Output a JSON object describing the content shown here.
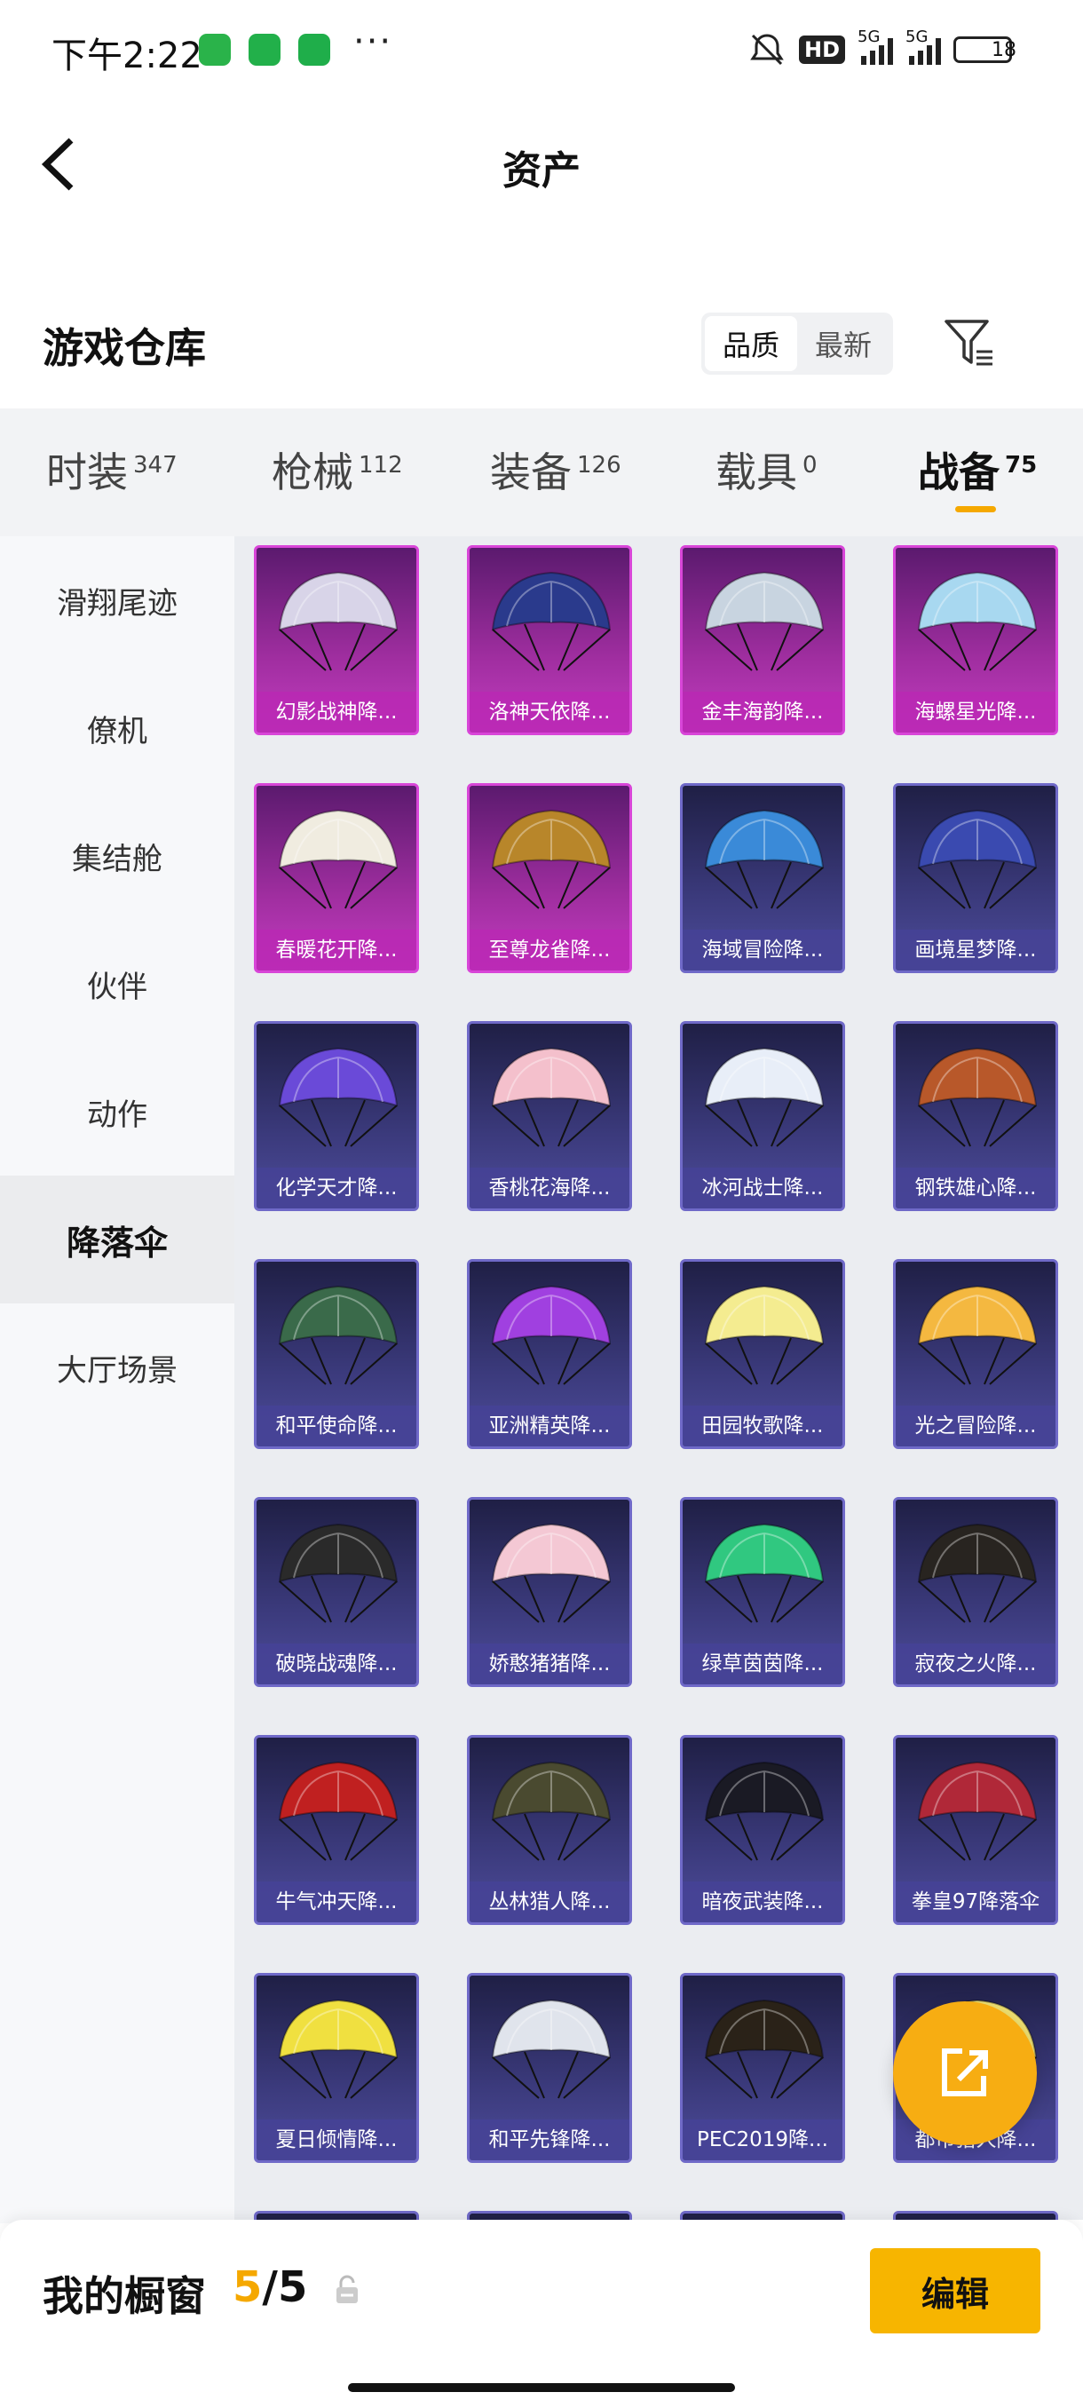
{
  "status_bar": {
    "time": "下午2:22",
    "network_hd": "HD",
    "signal_1": "5G",
    "signal_2": "5G",
    "battery": "18",
    "more": "···"
  },
  "nav": {
    "title": "资产"
  },
  "warehouse": {
    "title": "游戏仓库",
    "sort_options": [
      "品质",
      "最新"
    ],
    "sort_selected": "品质"
  },
  "tabs": [
    {
      "label": "时装",
      "count": "347"
    },
    {
      "label": "枪械",
      "count": "112"
    },
    {
      "label": "装备",
      "count": "126"
    },
    {
      "label": "载具",
      "count": "0"
    },
    {
      "label": "战备",
      "count": "75"
    }
  ],
  "sidebar": {
    "items": [
      "滑翔尾迹",
      "僚机",
      "集结舱",
      "伙伴",
      "动作",
      "降落伞",
      "大厅场景"
    ],
    "active": "降落伞"
  },
  "items": [
    {
      "name": "幻影战神降...",
      "rarity": "pink",
      "color": "#d8d4e8"
    },
    {
      "name": "洛神天依降...",
      "rarity": "pink",
      "color": "#2a3a8c"
    },
    {
      "name": "金丰海韵降...",
      "rarity": "pink",
      "color": "#c8d4e0"
    },
    {
      "name": "海螺星光降...",
      "rarity": "pink",
      "color": "#a8d8f0"
    },
    {
      "name": "春暖花开降...",
      "rarity": "pink",
      "color": "#f0ece0"
    },
    {
      "name": "至尊龙雀降...",
      "rarity": "pink",
      "color": "#b8862a"
    },
    {
      "name": "海域冒险降...",
      "rarity": "blue",
      "color": "#3a8ad8"
    },
    {
      "name": "画境星梦降...",
      "rarity": "blue",
      "color": "#3a4ab0"
    },
    {
      "name": "化学天才降...",
      "rarity": "blue",
      "color": "#6a4ad8"
    },
    {
      "name": "香桃花海降...",
      "rarity": "blue",
      "color": "#f4c0cc"
    },
    {
      "name": "冰河战士降...",
      "rarity": "blue",
      "color": "#e8eef8"
    },
    {
      "name": "钢铁雄心降...",
      "rarity": "blue",
      "color": "#b8582a"
    },
    {
      "name": "和平使命降...",
      "rarity": "blue",
      "color": "#3a6a4a"
    },
    {
      "name": "亚洲精英降...",
      "rarity": "blue",
      "color": "#a040e0"
    },
    {
      "name": "田园牧歌降...",
      "rarity": "blue",
      "color": "#f4ec90"
    },
    {
      "name": "光之冒险降...",
      "rarity": "blue",
      "color": "#f4b840"
    },
    {
      "name": "破晓战魂降...",
      "rarity": "blue",
      "color": "#2a2a2a"
    },
    {
      "name": "娇憨猪猪降...",
      "rarity": "blue",
      "color": "#f4c8d4"
    },
    {
      "name": "绿草茵茵降...",
      "rarity": "blue",
      "color": "#30c880"
    },
    {
      "name": "寂夜之火降...",
      "rarity": "blue",
      "color": "#282420"
    },
    {
      "name": "牛气冲天降...",
      "rarity": "blue",
      "color": "#c02020"
    },
    {
      "name": "丛林猎人降...",
      "rarity": "blue",
      "color": "#4a4a30"
    },
    {
      "name": "暗夜武装降...",
      "rarity": "blue",
      "color": "#1a1a24"
    },
    {
      "name": "拳皇97降落伞",
      "rarity": "blue",
      "color": "#b02838"
    },
    {
      "name": "夏日倾情降...",
      "rarity": "blue",
      "color": "#f0e040"
    },
    {
      "name": "和平先锋降...",
      "rarity": "blue",
      "color": "#e0e4ec"
    },
    {
      "name": "PEC2019降...",
      "rarity": "blue",
      "color": "#2a2218"
    },
    {
      "name": "都市猎人降...",
      "rarity": "blue",
      "color": "#f0e070"
    }
  ],
  "showcase": {
    "label": "我的橱窗",
    "current": "5",
    "separator": "/",
    "total": "5",
    "edit_label": "编辑"
  },
  "colors": {
    "accent": "#f5a800",
    "rare_pink": "#d845d8",
    "rare_blue": "#6f69c8"
  },
  "icons": [
    "back-arrow-icon",
    "filter-icon",
    "share-icon",
    "lock-icon",
    "wechat-icon",
    "shield-icon",
    "phone-icon",
    "mute-icon"
  ]
}
